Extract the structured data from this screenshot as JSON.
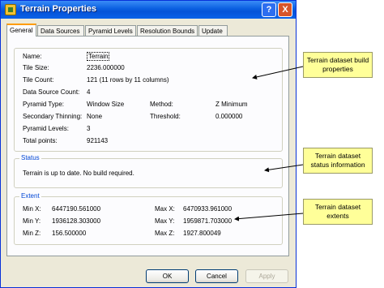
{
  "window": {
    "title": "Terrain Properties",
    "help_label": "?",
    "close_label": "X"
  },
  "tabs": [
    {
      "label": "General",
      "active": true
    },
    {
      "label": "Data Sources",
      "active": false
    },
    {
      "label": "Pyramid Levels",
      "active": false
    },
    {
      "label": "Resolution Bounds",
      "active": false
    },
    {
      "label": "Update",
      "active": false
    }
  ],
  "general": {
    "name_label": "Name:",
    "name_value": "Terrain",
    "tile_size_label": "Tile Size:",
    "tile_size_value": "2236.000000",
    "tile_count_label": "Tile Count:",
    "tile_count_value": "121 (11 rows by 11 columns)",
    "data_source_count_label": "Data Source Count:",
    "data_source_count_value": "4",
    "pyramid_type_label": "Pyramid Type:",
    "pyramid_type_value": "Window Size",
    "method_label": "Method:",
    "method_value": "Z Minimum",
    "secondary_thinning_label": "Secondary Thinning:",
    "secondary_thinning_value": "None",
    "threshold_label": "Threshold:",
    "threshold_value": "0.000000",
    "pyramid_levels_label": "Pyramid Levels:",
    "pyramid_levels_value": "3",
    "total_points_label": "Total points:",
    "total_points_value": "921143"
  },
  "status": {
    "title": "Status",
    "message": "Terrain is up to date. No build required."
  },
  "extent": {
    "title": "Extent",
    "min_x_label": "Min X:",
    "min_x_value": "6447190.561000",
    "max_x_label": "Max X:",
    "max_x_value": "6470933.961000",
    "min_y_label": "Min Y:",
    "min_y_value": "1936128.303000",
    "max_y_label": "Max Y:",
    "max_y_value": "1959871.703000",
    "min_z_label": "Min Z:",
    "min_z_value": "156.500000",
    "max_z_label": "Max Z:",
    "max_z_value": "1927.800049"
  },
  "buttons": {
    "ok": "OK",
    "cancel": "Cancel",
    "apply": "Apply"
  },
  "callouts": {
    "build_properties": "Terrain dataset build properties",
    "status_information": "Terrain dataset status information",
    "extents": "Terrain dataset extents"
  },
  "colors": {
    "titlebar": "#0a5fe0",
    "group_title": "#0046d5",
    "callout_fill": "#ffff99",
    "tab_accent": "#ff9c00"
  }
}
